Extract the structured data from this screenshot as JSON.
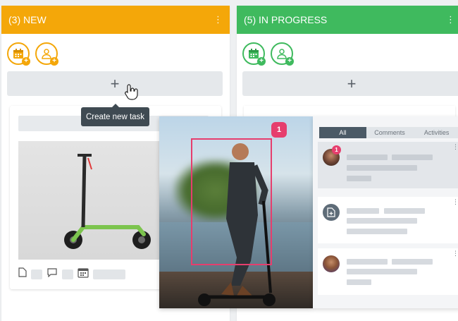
{
  "columns": [
    {
      "title": "(3) NEW",
      "menu_glyph": "⋮",
      "add_glyph": "+",
      "color": "#f4a709"
    },
    {
      "title": "(5) IN PROGRESS",
      "menu_glyph": "⋮",
      "add_glyph": "+",
      "color": "#3fba5e"
    }
  ],
  "tooltip": "Create new task",
  "annotation_badge": "1",
  "panel": {
    "tabs": [
      "All",
      "Comments",
      "Activities"
    ],
    "active_tab": "All",
    "notification_badge": "1"
  },
  "colors": {
    "accent_pink": "#e63e6d",
    "panel_tab_active": "#4b5a66"
  },
  "icons": [
    "calendar-add-icon",
    "user-add-icon",
    "hand-cursor-icon",
    "document-icon",
    "comment-icon",
    "calendar-icon",
    "add-file-icon"
  ]
}
